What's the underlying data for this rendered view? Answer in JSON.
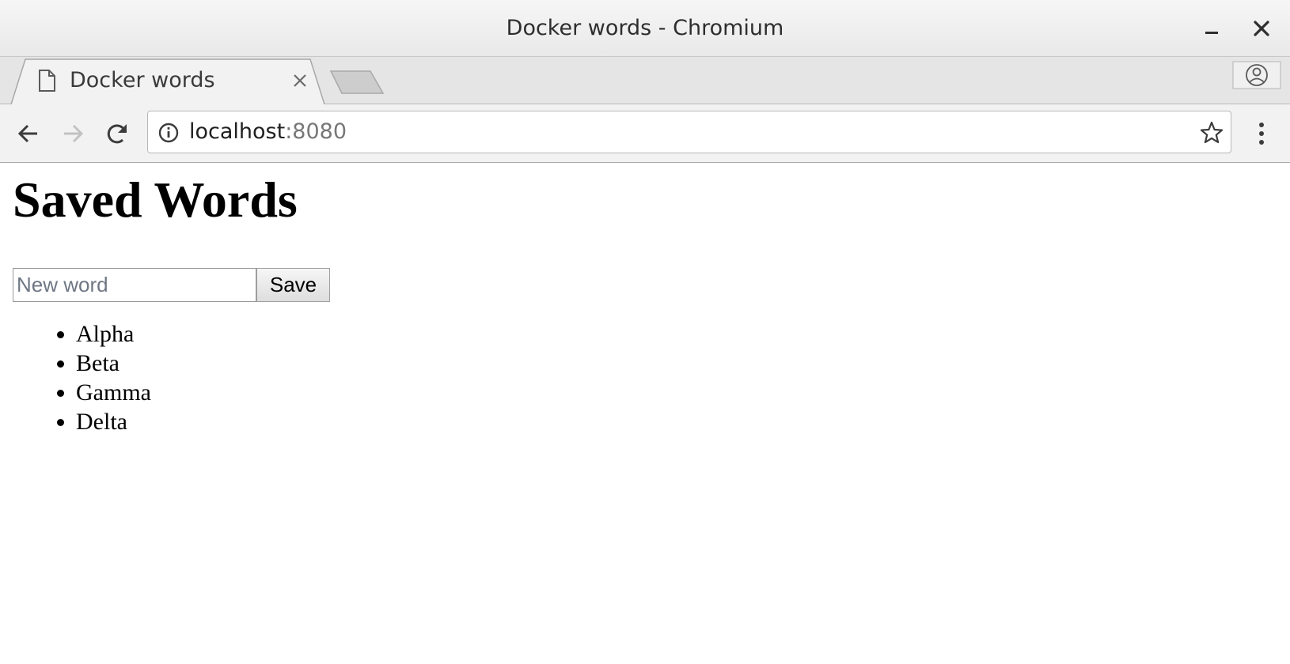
{
  "window": {
    "title": "Docker words - Chromium"
  },
  "tab": {
    "title": "Docker words"
  },
  "address_bar": {
    "host": "localhost",
    "port": ":8080"
  },
  "page": {
    "heading": "Saved Words",
    "input": {
      "value": "",
      "placeholder": "New word"
    },
    "save_label": "Save",
    "words": [
      "Alpha",
      "Beta",
      "Gamma",
      "Delta"
    ]
  },
  "icons": {
    "minimize": "minimize-icon",
    "close": "close-icon",
    "tab_favicon": "document-icon",
    "tab_close": "close-tab-icon",
    "new_tab": "new-tab-icon",
    "profile": "profile-icon",
    "back": "back-arrow-icon",
    "forward": "forward-arrow-icon",
    "reload": "reload-icon",
    "site_info": "info-icon",
    "bookmark": "star-icon",
    "menu": "kebab-menu-icon"
  }
}
